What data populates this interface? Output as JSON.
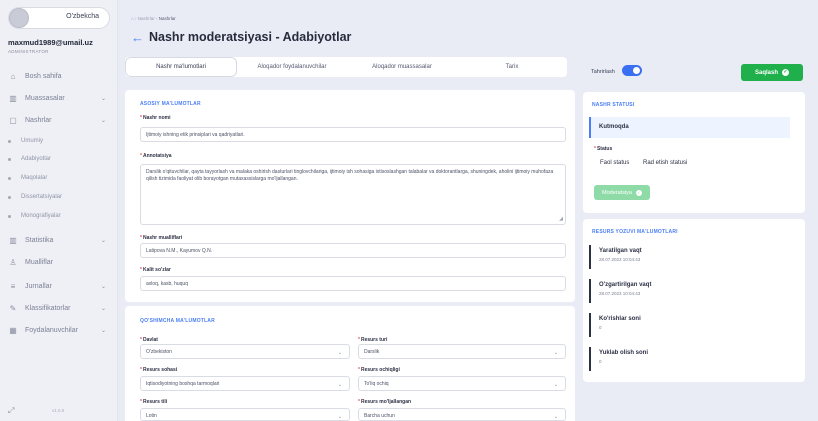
{
  "user": {
    "language": "O'zbekcha",
    "email": "maxmud1989@umail.uz",
    "role": "ADMINISTRATOR"
  },
  "sidebar": {
    "items": [
      {
        "label": "Bosh sahifa",
        "icon": "home-icon"
      },
      {
        "label": "Muassasalar",
        "icon": "building-icon"
      },
      {
        "label": "Nashrlar",
        "icon": "document-icon"
      },
      {
        "label": "Statistika",
        "icon": "building-icon"
      },
      {
        "label": "Mualliflar",
        "icon": "user-icon"
      },
      {
        "label": "Jurnallar",
        "icon": "list-icon"
      },
      {
        "label": "Klassifikatorlar",
        "icon": "brush-icon"
      },
      {
        "label": "Foydalanuvchilar",
        "icon": "users-icon"
      }
    ],
    "subitems": [
      "Umumiy",
      "Adabiyotlar",
      "Maqolalar",
      "Dissertatsiyalar",
      "Monografiyalar"
    ],
    "footer": "v1.0.0"
  },
  "breadcrumb": {
    "parent": "Nashrlar",
    "current": "Nashrlar"
  },
  "page_title": "Nashr moderatsiyasi - Adabiyotlar",
  "tabs": [
    "Nashr ma'lumotlari",
    "Aloqador foydalanuvchilar",
    "Aloqador muassasalar",
    "Tarix"
  ],
  "basic": {
    "section_title": "ASOSIY MA'LUMOTLAR",
    "name_label": "Nashr nomi",
    "name_value": "Ijtimoiy ishning etik prinsiplari va qadriyatlari.",
    "annot_label": "Annotatsiya",
    "annot_value": "Darslik o'qituvchilar, qayta tayyorlash va malaka oshirish dasturlari tinglovchilariga, ijtimoiy ish sohasiga ixtisoslashgan talabalar va doktorantlarga, shuningdek, aholini ijtimoiy muhofaza qilish tizimida faoliyat olib borayotgan mutaxassislarga mo'ljallangan.",
    "authors_label": "Nashr mualliflari",
    "authors_value": "Latipova N.M., Kayumov Q.N.",
    "keywords_label": "Kalit so'zlar",
    "keywords_value": "axloq, kasb, huquq"
  },
  "extra": {
    "section_title": "QO'SHIMCHA MA'LUMOTLAR",
    "country_label": "Davlat",
    "country_value": "O'zbekiston",
    "type_label": "Resurs turi",
    "type_value": "Darslik",
    "field_label": "Resurs sohasi",
    "field_value": "Iqtisodiyotning boshqa tarmoqlari",
    "access_label": "Resurs ochiqligi",
    "access_value": "To'liq ochiq",
    "lang_label": "Resurs tili",
    "lang_value": "Lotin",
    "audience_label": "Resurs mo'ljallangan",
    "audience_value": "Barcha uchun"
  },
  "controls": {
    "edit_label": "Tahrirlash",
    "edit_enabled": true,
    "save_label": "Saqlash",
    "accent": "#3b6ff1",
    "save_color": "#1fb04b"
  },
  "status_card": {
    "section_title": "NASHR STATUSI",
    "status_value": "Kutmoqda",
    "status_label": "Status",
    "option_accept": "Faol status",
    "option_reject": "Rad etish statusi",
    "moderate_label": "Moderatsiya"
  },
  "resource_card": {
    "section_title": "RESURS YOZUVI MA'LUMOTLARI",
    "created_label": "Yaratilgan vaqt",
    "created_value": "28.07.2023 10:04:43",
    "updated_label": "O'zgartirilgan vaqt",
    "updated_value": "28.07.2023 10:04:43",
    "views_label": "Ko'rishlar soni",
    "views_value": "0",
    "downloads_label": "Yuklab olish soni",
    "downloads_value": "0"
  }
}
